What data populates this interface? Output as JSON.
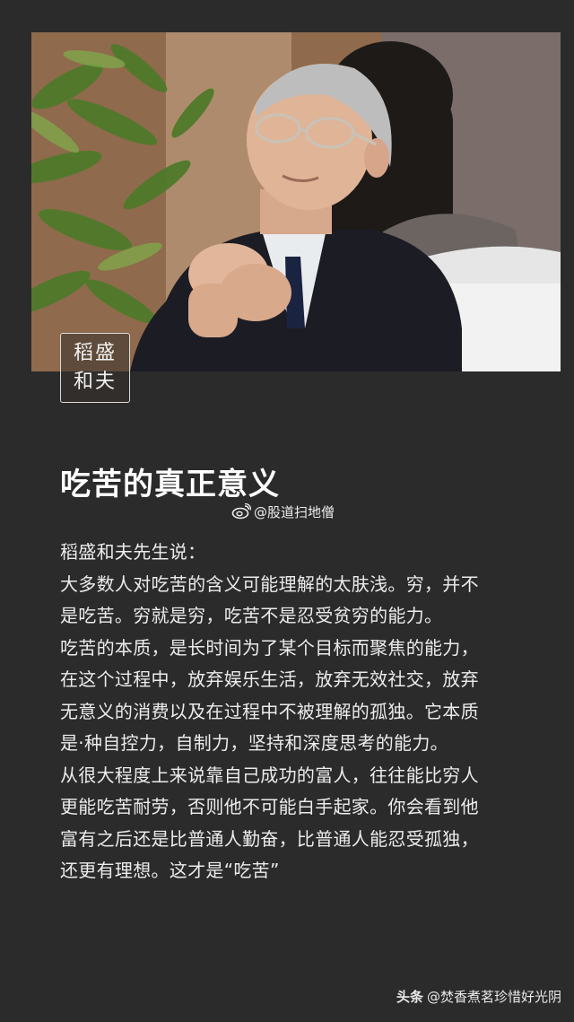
{
  "photo": {
    "badge_line1": "稻盛",
    "badge_line2": "和夫"
  },
  "article": {
    "title": "吃苦的真正意义",
    "watermark_icon": "weibo-icon",
    "watermark": "@股道扫地僧",
    "paragraphs": [
      "稻盛和夫先生说：",
      "大多数人对吃苦的含义可能理解的太肤浅。穷，并不是吃苦。穷就是穷，吃苦不是忍受贫穷的能力。",
      "吃苦的本质，是长时间为了某个目标而聚焦的能力，在这个过程中，放弃娱乐生活，放弃无效社交，放弃无意义的消费以及在过程中不被理解的孤独。它本质是·种自控力，自制力，坚持和深度思考的能力。",
      "从很大程度上来说靠自己成功的富人，往往能比穷人更能吃苦耐劳，否则他不可能白手起家。你会看到他富有之后还是比普通人勤奋，比普通人能忍受孤独，还更有理想。这才是“吃苦”"
    ]
  },
  "footer": {
    "brand": "头条",
    "handle": "@焚香煮茗珍惜好光阴"
  },
  "colors": {
    "background": "#2b2b2b",
    "text": "#ececec",
    "title": "#ffffff"
  }
}
